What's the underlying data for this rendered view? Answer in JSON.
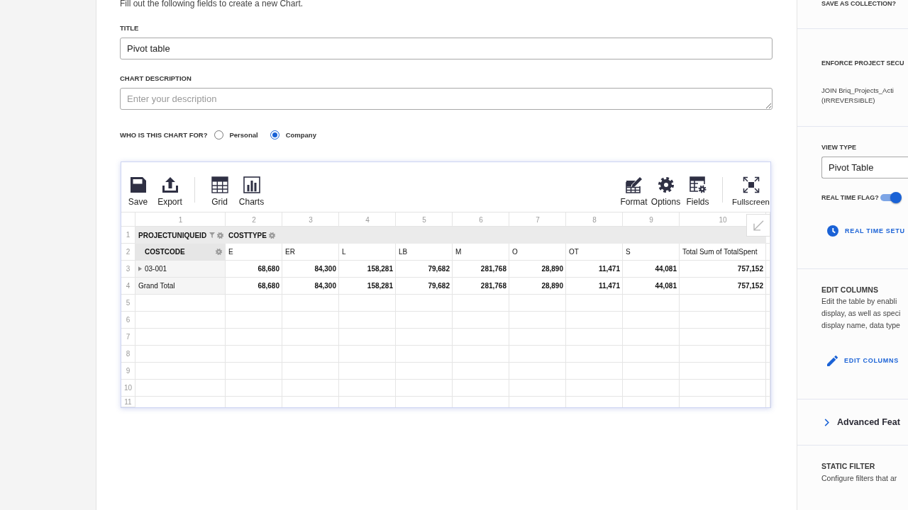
{
  "intro": "Fill out the following fields to create a new Chart.",
  "title_field": {
    "label": "TITLE",
    "value": "Pivot table"
  },
  "description_field": {
    "label": "CHART DESCRIPTION",
    "placeholder": "Enter your description"
  },
  "audience": {
    "label": "WHO IS THIS CHART FOR?",
    "options": [
      {
        "label": "Personal",
        "selected": false
      },
      {
        "label": "Company",
        "selected": true
      }
    ]
  },
  "pivot": {
    "toolbar": {
      "left_groups": [
        [
          "Save",
          "Export"
        ],
        [
          "Grid",
          "Charts"
        ]
      ],
      "right_groups": [
        [
          "Format",
          "Options",
          "Fields"
        ],
        [
          "Fullscreen"
        ]
      ]
    },
    "column_numbers": [
      "1",
      "2",
      "3",
      "4",
      "5",
      "6",
      "7",
      "8",
      "9",
      "10"
    ],
    "row_numbers": [
      "1",
      "2",
      "3",
      "4",
      "5",
      "6",
      "7",
      "8",
      "9",
      "10",
      "11"
    ],
    "report_filter": "PROJECTUNIQUEID",
    "column_field": "COSTTYPE",
    "row_field": "COSTCODE",
    "columns": [
      "E",
      "ER",
      "L",
      "LB",
      "M",
      "O",
      "OT",
      "S",
      "Total Sum of TotalSpent"
    ],
    "rows": [
      {
        "label": "03-001",
        "expanded": false,
        "values": [
          "68,680",
          "84,300",
          "158,281",
          "79,682",
          "281,768",
          "28,890",
          "11,471",
          "44,081",
          "757,152"
        ]
      }
    ],
    "grand_total": {
      "label": "Grand Total",
      "values": [
        "68,680",
        "84,300",
        "158,281",
        "79,682",
        "281,768",
        "28,890",
        "11,471",
        "44,081",
        "757,152"
      ]
    }
  },
  "side_panel": {
    "save_as_collection": {
      "label": "SAVE AS COLLECTION?"
    },
    "project_security": {
      "label": "ENFORCE PROJECT SECU",
      "join_note": [
        "JOIN Briq_Projects_Acti",
        "(IRREVERSIBLE)"
      ]
    },
    "view_type": {
      "label": "VIEW TYPE",
      "value": "Pivot Table"
    },
    "real_time_flag": {
      "label": "REAL TIME FLAG?",
      "on": true
    },
    "real_time_setup": {
      "label": "REAL TIME SETU"
    },
    "edit_columns": {
      "title": "EDIT COLUMNS",
      "description_lines": [
        "Edit the table by enabli",
        "display, as well as speci",
        "display name, data type"
      ],
      "button": "EDIT COLUMNS"
    },
    "advanced_features": {
      "label": "Advanced Feat",
      "expanded": false
    },
    "static_filter": {
      "title": "STATIC FILTER",
      "description_lines": [
        "Configure filters that ar"
      ]
    }
  }
}
